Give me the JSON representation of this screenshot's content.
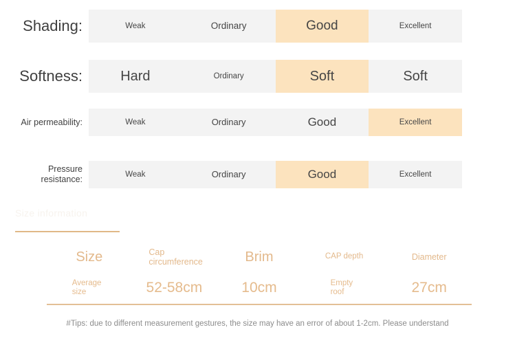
{
  "ratings": {
    "rows": [
      {
        "label": "Shading:",
        "cells": [
          {
            "text": "Weak",
            "active": false
          },
          {
            "text": "Ordinary",
            "active": false
          },
          {
            "text": "Good",
            "active": true
          },
          {
            "text": "Excellent",
            "active": false
          }
        ]
      },
      {
        "label": "Softness:",
        "cells": [
          {
            "text": "Hard",
            "active": false
          },
          {
            "text": "Ordinary",
            "active": false
          },
          {
            "text": "Soft",
            "active": true
          },
          {
            "text": "Soft",
            "active": false
          }
        ]
      },
      {
        "label": "Air permeability:",
        "cells": [
          {
            "text": "Weak",
            "active": false
          },
          {
            "text": "Ordinary",
            "active": false
          },
          {
            "text": "Good",
            "active": false
          },
          {
            "text": "Excellent",
            "active": true
          }
        ]
      },
      {
        "label": "Pressure\nresistance:",
        "cells": [
          {
            "text": "Weak",
            "active": false
          },
          {
            "text": "Ordinary",
            "active": false
          },
          {
            "text": "Good",
            "active": true
          },
          {
            "text": "Excellent",
            "active": false
          }
        ]
      }
    ]
  },
  "size_section": {
    "heading": "Size information",
    "table": {
      "headers": [
        "Size",
        "Cap circumference",
        "Brim",
        "CAP depth",
        "Diameter"
      ],
      "values": [
        "Average size",
        "52-58cm",
        "10cm",
        "Empty roof",
        "27cm"
      ]
    },
    "tip": "#Tips: due to different measurement gestures, the size may have an error of about 1-2cm. Please understand"
  },
  "colors": {
    "highlight": "#fce3be",
    "bar_background": "#f3f3f3",
    "accent_gold": "#e0b887",
    "label_text": "#3f3f3f",
    "tip_text": "#8c8c8c"
  }
}
